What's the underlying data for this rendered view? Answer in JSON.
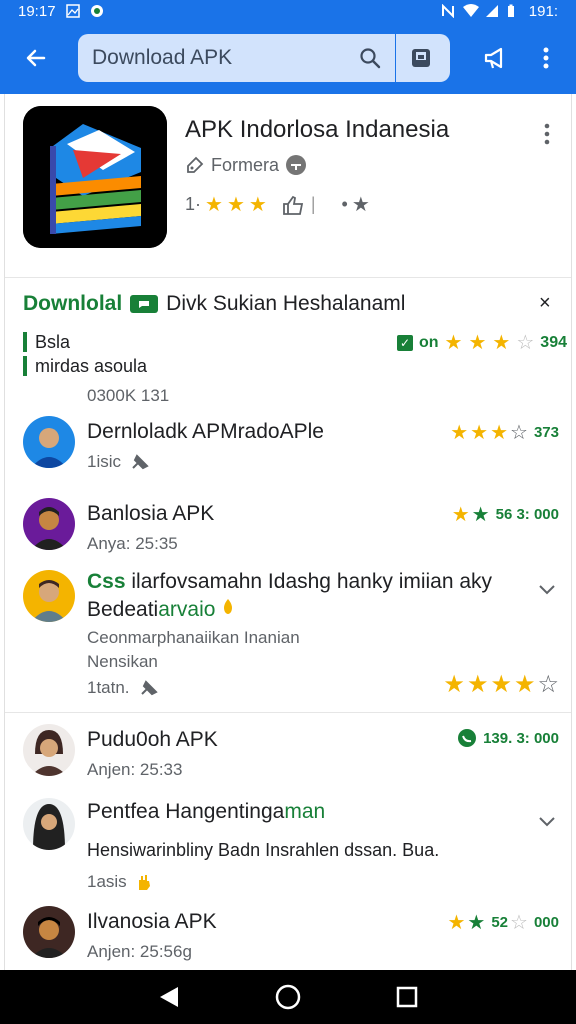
{
  "status_bar": {
    "time": "19:17",
    "battery": "191:"
  },
  "search": {
    "query": "Download APK"
  },
  "app": {
    "title": "APK Indorlosa Indanesia",
    "developer": "Formera",
    "rating_prefix": "1·",
    "rating_mid": "•"
  },
  "reviews_header": {
    "green_label": "Downlolal",
    "title": "Divk Sukian Heshalanaml",
    "close": "×"
  },
  "filters": {
    "line1": "Bsla",
    "line2": "mirdas asoula",
    "summary_prefix": "on",
    "summary_score": "394"
  },
  "count_line": "0300K 131",
  "reviews": [
    {
      "name": "Dernloladk APMradoAPle",
      "meta": "1isic",
      "score": "373",
      "avatar_color": "#1e88e5"
    },
    {
      "name": "Banlosia APK",
      "meta": "Anya: 25:35",
      "score": "56 3: 000",
      "avatar_color": "#6a1b9a"
    },
    {
      "name_green": "Css",
      "name": "ilarfovsamahn Idashg hanky imiian aky",
      "name2_black": "Bedeati",
      "name2_green": "arvaio",
      "body1": "Ceonmarphanaiikan Inanian",
      "body2": "Nensikan",
      "meta": "1tatn.",
      "avatar_color": "#f4b400"
    },
    {
      "name": "Pudu0oh APK",
      "meta": "Anjen: 25:33",
      "score": "139. 3: 000",
      "avatar_color": "#5d4037"
    },
    {
      "name_black": "Pentfea Hangentinga",
      "name_green": "man",
      "body1": "Hensiwarinbliny Badn Insrahlen dssan. Bua.",
      "meta": "1asis",
      "avatar_color": "#90a4ae"
    },
    {
      "name": "Ilvanosia APK",
      "meta": "Anjen: 25:56g",
      "score": "52",
      "score2": "000",
      "avatar_color": "#3e2723"
    }
  ],
  "colors": {
    "primary_blue": "#1a73e8",
    "search_bg": "#d2e3fc",
    "green": "#188038",
    "star": "#f4b400"
  }
}
